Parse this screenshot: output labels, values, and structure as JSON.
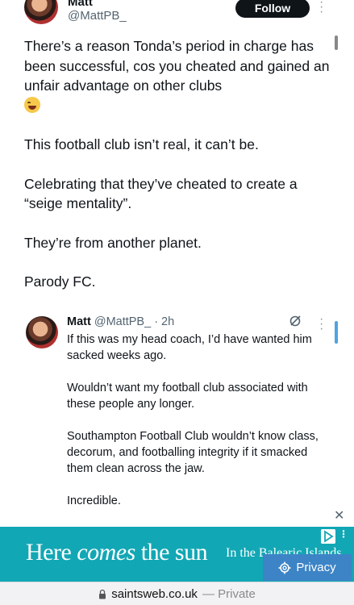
{
  "main_tweet": {
    "author_name": "Matt",
    "author_handle": "@MattPB_",
    "follow_label": "Follow",
    "paragraphs": [
      "There’s a reason Tonda’s period in charge has been successful, cos you cheated and gained an unfair advantage on other clubs",
      "This football club isn’t real, it can’t be.",
      "Celebrating that they’ve cheated to create a “seige mentality”.",
      "They’re from another planet.",
      "Parody FC."
    ]
  },
  "reply_tweet": {
    "author_name": "Matt",
    "author_handle": "@MattPB_",
    "time": "· 2h",
    "paragraphs": [
      "If this was my head coach, I’d have wanted him sacked weeks ago.",
      "Wouldn’t want my football club associated with these people any longer.",
      "Southampton Football Club wouldn’t know class, decorum, and footballing integrity if it smacked them clean across the jaw.",
      "Incredible."
    ]
  },
  "ad": {
    "headline_part1": "Here ",
    "headline_italic": "comes",
    "headline_part2": " the sun",
    "subline": "In the Balearic Islands",
    "background_color": "#12a7b5",
    "privacy_label": "Privacy"
  },
  "browser": {
    "domain": "saintsweb.co.uk",
    "mode": "— Private"
  },
  "icons": {
    "more": "more-dots-icon",
    "grok": "grok-icon",
    "close": "close-icon",
    "lock": "lock-icon",
    "privacy": "privacy-gear-icon",
    "adchoices": "adchoices-icon"
  }
}
